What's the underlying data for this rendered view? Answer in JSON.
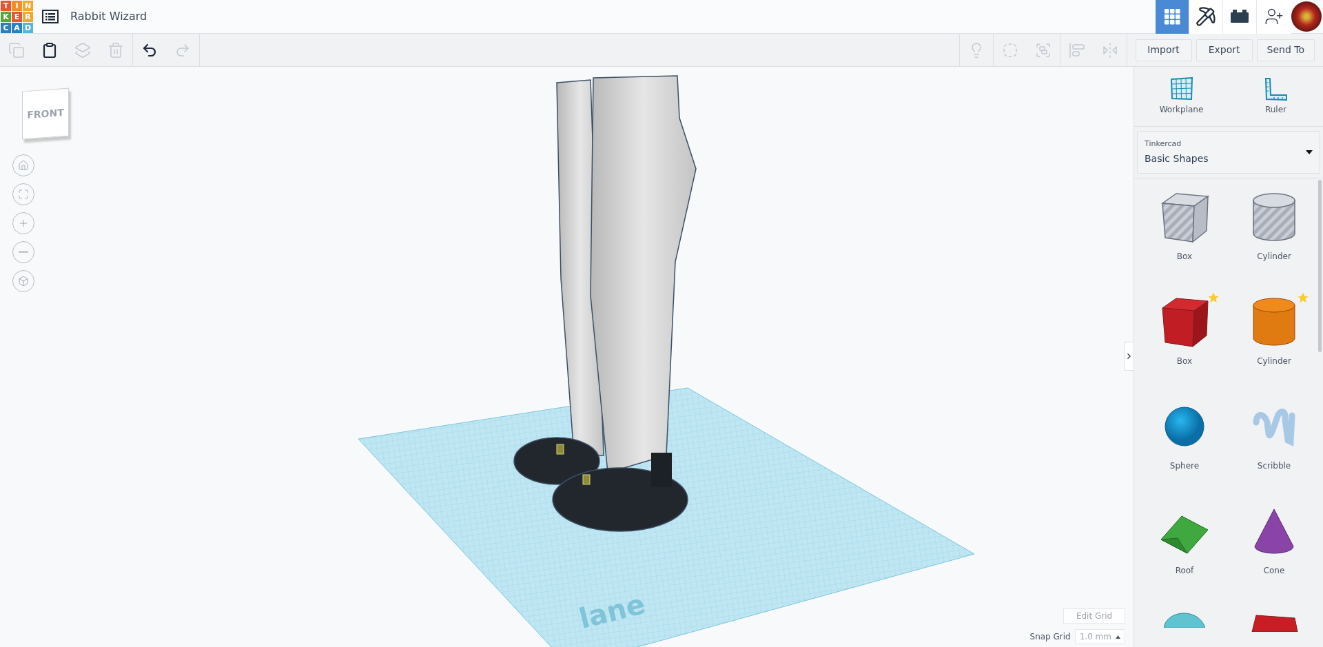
{
  "logo": {
    "letters": [
      {
        "text": "T",
        "color": "#e8542b"
      },
      {
        "text": "I",
        "color": "#f08d2c"
      },
      {
        "text": "N",
        "color": "#f3a72b"
      },
      {
        "text": "K",
        "color": "#5aa33a"
      },
      {
        "text": "E",
        "color": "#e8542b"
      },
      {
        "text": "R",
        "color": "#f3a72b"
      },
      {
        "text": "C",
        "color": "#2a7fc2"
      },
      {
        "text": "A",
        "color": "#2a7fc2"
      },
      {
        "text": "D",
        "color": "#59b5d7"
      }
    ]
  },
  "project": {
    "title": "Rabbit Wizard"
  },
  "view_buttons": [
    {
      "kind": "grid",
      "selected": true
    },
    {
      "kind": "pickaxe",
      "selected": false
    },
    {
      "kind": "brick",
      "selected": false
    }
  ],
  "edit_tools": [
    {
      "kind": "copy",
      "disabled": true
    },
    {
      "kind": "paste",
      "disabled": false
    },
    {
      "kind": "duplicate",
      "disabled": true
    },
    {
      "kind": "delete",
      "disabled": true
    },
    {
      "kind": "undo",
      "disabled": false
    },
    {
      "kind": "redo",
      "disabled": true
    }
  ],
  "shape_tools": [
    {
      "kind": "note",
      "disabled": true
    },
    {
      "kind": "hole",
      "disabled": true
    },
    {
      "kind": "group",
      "disabled": true
    },
    {
      "kind": "align",
      "disabled": true
    },
    {
      "kind": "mirror",
      "disabled": true
    }
  ],
  "actions": [
    "Import",
    "Export",
    "Send To"
  ],
  "panel_tools": [
    {
      "kind": "workplane",
      "label": "Workplane"
    },
    {
      "kind": "ruler",
      "label": "Ruler"
    }
  ],
  "library": {
    "source": "Tinkercad",
    "selection": "Basic Shapes"
  },
  "shapes": [
    {
      "kind": "box-hole",
      "label": "Box",
      "starred": false
    },
    {
      "kind": "cylinder-hole",
      "label": "Cylinder",
      "starred": false
    },
    {
      "kind": "box",
      "label": "Box",
      "starred": true
    },
    {
      "kind": "cylinder",
      "label": "Cylinder",
      "starred": true
    },
    {
      "kind": "sphere",
      "label": "Sphere",
      "starred": false
    },
    {
      "kind": "scribble",
      "label": "Scribble",
      "starred": false
    },
    {
      "kind": "roof",
      "label": "Roof",
      "starred": false
    },
    {
      "kind": "cone",
      "label": "Cone",
      "starred": false
    },
    {
      "kind": "half-cylinder",
      "starred": false
    },
    {
      "kind": "text",
      "starred": false
    }
  ],
  "view_cube": {
    "face": "FRONT"
  },
  "nav_controls": [
    {
      "kind": "home"
    },
    {
      "kind": "fit"
    },
    {
      "kind": "zoom-in"
    },
    {
      "kind": "zoom-out"
    },
    {
      "kind": "ortho"
    }
  ],
  "workplane": {
    "label": "lane"
  },
  "grid": {
    "edit_button": "Edit Grid",
    "snap_label": "Snap Grid",
    "snap_value": "1.0 mm"
  }
}
